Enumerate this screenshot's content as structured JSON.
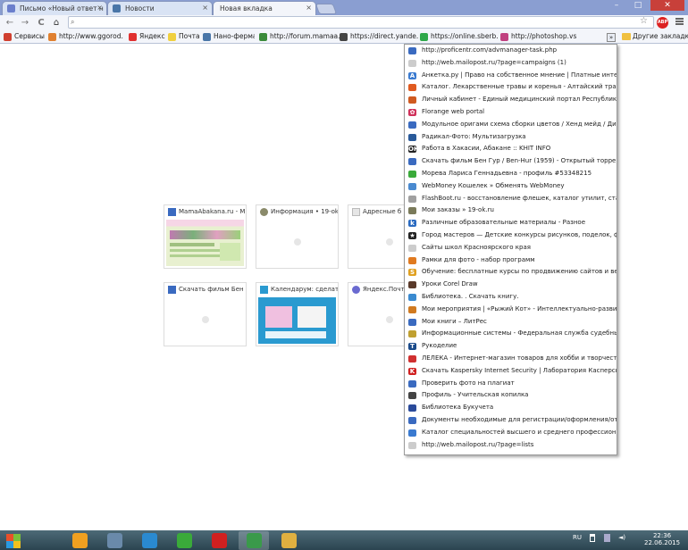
{
  "window": {
    "minimize": "–",
    "maximize": "□",
    "close": "✕"
  },
  "tabs": [
    {
      "label": "Письмо «Новый ответ н",
      "icon": "mail-icon",
      "color": "#6b7fcc"
    },
    {
      "label": "Новости",
      "icon": "vk-icon",
      "color": "#4a76a8"
    },
    {
      "label": "Новая вкладка",
      "icon": "none",
      "color": "#f3f5fa",
      "active": true
    }
  ],
  "toolbar": {
    "back": "←",
    "forward": "→",
    "reload": "C",
    "home": "⌂",
    "address_value": "",
    "search_icon": "🔍",
    "star": "☆",
    "abp_label": "ABP"
  },
  "bookmarks": [
    {
      "label": "Сервисы",
      "icon": "apps-icon",
      "color": "#d04030"
    },
    {
      "label": "http://www.ggorod...",
      "icon": "house-icon",
      "color": "#e08030"
    },
    {
      "label": "Яндекс",
      "icon": "yandex-icon",
      "color": "#e03030"
    },
    {
      "label": "Почта",
      "icon": "mail-icon",
      "color": "#f0d040"
    },
    {
      "label": "Нано-ферма",
      "icon": "vk-icon",
      "color": "#4a76a8"
    },
    {
      "label": "http://forum.mamaa...",
      "icon": "forum-icon",
      "color": "#3a8a3a"
    },
    {
      "label": "https://direct.yande...",
      "icon": "direct-icon",
      "color": "#444444"
    },
    {
      "label": "https://online.sberb...",
      "icon": "sber-icon",
      "color": "#2ea84a"
    },
    {
      "label": "http://photoshop.vs...",
      "icon": "photoshop-icon",
      "color": "#c04080"
    }
  ],
  "bookmarks_overflow": "»",
  "other_bookmarks": "Другие закладки",
  "tiles": [
    {
      "title": "MamaAbakana.ru - М",
      "icon": "mama-icon",
      "color": "#3a6ac0",
      "thumb": "site"
    },
    {
      "title": "Информация • 19-ok",
      "icon": "gear-icon",
      "color": "#8a8a6a",
      "thumb": ""
    },
    {
      "title": "Адресные б",
      "icon": "doc-icon",
      "color": "#bbbbbb",
      "thumb": ""
    },
    {
      "title": "Скачать фильм Бен",
      "icon": "film-icon",
      "color": "#3a6ac0",
      "thumb": ""
    },
    {
      "title": "Календарум: сделат",
      "icon": "calendar-icon",
      "color": "#2a9ad0",
      "thumb": "calendar"
    },
    {
      "title": "Яндекс.Почт",
      "icon": "ymail-icon",
      "color": "#6a6ad0",
      "thumb": ""
    }
  ],
  "dropdown": [
    {
      "label": "http://proficentr.com/advmanager-task.php",
      "icon": "chart-icon",
      "color": "#3a6ac0",
      "glyph": ""
    },
    {
      "label": "http://web.mailopost.ru/?page=campaigns (1)",
      "icon": "page-icon",
      "color": "#cccccc",
      "glyph": ""
    },
    {
      "label": "Анкетка.ру | Право на собственное мнение | Платные интер...",
      "icon": "a-icon",
      "color": "#3a7ad0",
      "glyph": "A"
    },
    {
      "label": "Каталог. Лекарственные травы и коренья - Алтайский трав...",
      "icon": "circle-icon",
      "color": "#e05a20",
      "glyph": ""
    },
    {
      "label": "Личный кабинет - Единый медицинский портал Республик...",
      "icon": "med-icon",
      "color": "#d05a20",
      "glyph": ""
    },
    {
      "label": "Florange web portal",
      "icon": "flower-icon",
      "color": "#d0305a",
      "glyph": "✿"
    },
    {
      "label": "Модульное оригами схема сборки цветов / Хенд мейд / Ди...",
      "icon": "square-icon",
      "color": "#3a6ac0",
      "glyph": ""
    },
    {
      "label": "Радикал-Фото: Мультизагрузка",
      "icon": "camera-icon",
      "color": "#2a5a9a",
      "glyph": ""
    },
    {
      "label": "Работа в Хакасии, Абакане :: KHIT INFO",
      "icon": "khit-icon",
      "color": "#222222",
      "glyph": "ОК"
    },
    {
      "label": "Скачать фильм Бен Гур / Ben-Hur (1959) - Открытый торрен...",
      "icon": "film-icon",
      "color": "#3a6ac0",
      "glyph": ""
    },
    {
      "label": "Морева Лариса Геннадьевна - профиль #53348215",
      "icon": "ok-icon",
      "color": "#3aaa3a",
      "glyph": ""
    },
    {
      "label": "WebMoney Кошелек » Обменять WebMoney",
      "icon": "globe-icon",
      "color": "#4a8ad0",
      "glyph": ""
    },
    {
      "label": "FlashBoot.ru - восстановление флешек, каталог утилит, стат...",
      "icon": "flash-icon",
      "color": "#a0a0a0",
      "glyph": ""
    },
    {
      "label": "Мои заказы » 19-ok.ru",
      "icon": "gear-icon",
      "color": "#7a7a5a",
      "glyph": ""
    },
    {
      "label": "Различные образовательные материалы - Разное",
      "icon": "k-icon",
      "color": "#2a6ac0",
      "glyph": "k"
    },
    {
      "label": "Город мастеров — Детские конкурсы рисунков, поделок, ф...",
      "icon": "star-icon",
      "color": "#222222",
      "glyph": "★"
    },
    {
      "label": "Сайты школ Красноярского края",
      "icon": "page-icon",
      "color": "#cccccc",
      "glyph": ""
    },
    {
      "label": "Рамки для фото - набор программ",
      "icon": "frame-icon",
      "color": "#e07a20",
      "glyph": ""
    },
    {
      "label": "Обучение: бесплатные курсы по продвижению сайтов и ве...",
      "icon": "s-icon",
      "color": "#e0a020",
      "glyph": "S"
    },
    {
      "label": "Уроки Corel Draw",
      "icon": "corel-icon",
      "color": "#5a3a2a",
      "glyph": ""
    },
    {
      "label": "Библиотека. . Скачать книгу.",
      "icon": "drop-icon",
      "color": "#3a8ad0",
      "glyph": ""
    },
    {
      "label": "Мои мероприятия | «Рыжий Кот» - Интеллектуально-разви...",
      "icon": "cat-icon",
      "color": "#d07a20",
      "glyph": ""
    },
    {
      "label": "Мои книги – ЛитРес",
      "icon": "book-icon",
      "color": "#3a6ac0",
      "glyph": ""
    },
    {
      "label": "Информационные системы - Федеральная служба судебны...",
      "icon": "emblem-icon",
      "color": "#c0a030",
      "glyph": ""
    },
    {
      "label": "Рукоделие",
      "icon": "t-icon",
      "color": "#1a4a8a",
      "glyph": "T"
    },
    {
      "label": "ЛЕЛЕКА - Интернет-магазин товаров для хобби и творчест...",
      "icon": "leleka-icon",
      "color": "#d03030",
      "glyph": ""
    },
    {
      "label": "Скачать Kaspersky Internet Security | Лаборатория Касперск...",
      "icon": "kaspersky-icon",
      "color": "#d02020",
      "glyph": "K"
    },
    {
      "label": "Проверить фото на плагиат",
      "icon": "photo-icon",
      "color": "#3a6ac0",
      "glyph": ""
    },
    {
      "label": "Профиль - Учительская копилка",
      "icon": "owl-icon",
      "color": "#444444",
      "glyph": ""
    },
    {
      "label": "Библиотека Букучета",
      "icon": "b-icon",
      "color": "#2a4a9a",
      "glyph": ""
    },
    {
      "label": "Документы необходимые для регистрации/оформления/от...",
      "icon": "e-icon",
      "color": "#3a6ac0",
      "glyph": ""
    },
    {
      "label": "Каталог специальностей высшего и среднего профессиона...",
      "icon": "globe-icon",
      "color": "#3a7ad0",
      "glyph": ""
    },
    {
      "label": "http://web.mailopost.ru/?page=lists",
      "icon": "page-icon",
      "color": "#cccccc",
      "glyph": ""
    }
  ],
  "taskbar": {
    "apps": [
      {
        "name": "winamp-icon",
        "color": "#f0a020",
        "active": false
      },
      {
        "name": "calculator-icon",
        "color": "#6a8aaa",
        "active": false
      },
      {
        "name": "maxthon-icon",
        "color": "#2a8ad0",
        "active": false
      },
      {
        "name": "utorrent-icon",
        "color": "#3aaa3a",
        "active": false
      },
      {
        "name": "opera-icon",
        "color": "#d02020",
        "active": false
      },
      {
        "name": "chrome-icon",
        "color": "#3a9a4a",
        "active": true
      },
      {
        "name": "folder-icon",
        "color": "#e0b040",
        "active": false
      }
    ],
    "lang": "RU",
    "time": "22:36",
    "date": "22.06.2015"
  }
}
